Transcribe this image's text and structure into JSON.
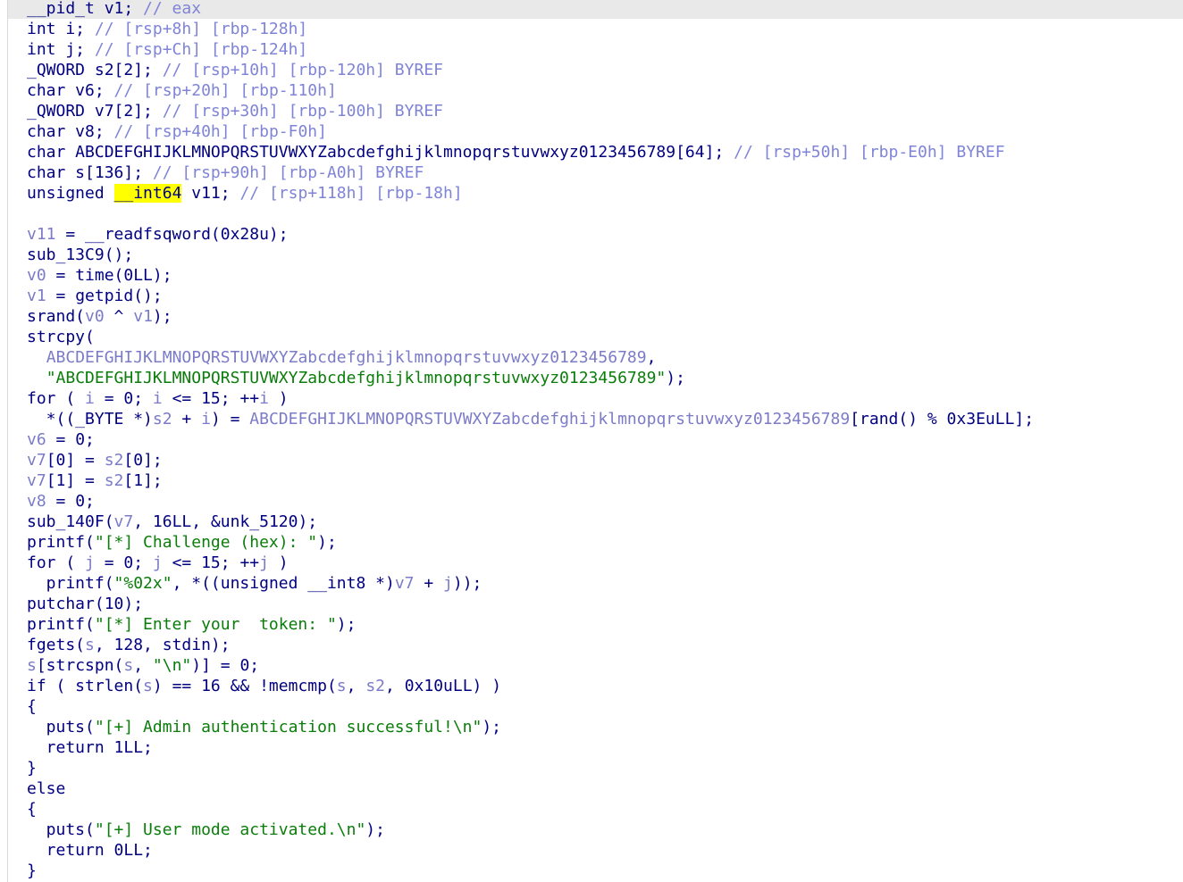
{
  "editor": {
    "highlight_color": "#ffff00",
    "current_line_color": "#e9e9e9",
    "lines": [
      {
        "current": true,
        "tokens": [
          {
            "t": "__pid_t v1; ",
            "c": "plain"
          },
          {
            "t": "// eax",
            "c": "comment"
          }
        ]
      },
      {
        "tokens": [
          {
            "t": "int i; ",
            "c": "plain"
          },
          {
            "t": "// [rsp+8h] [rbp-128h]",
            "c": "comment"
          }
        ]
      },
      {
        "tokens": [
          {
            "t": "int j; ",
            "c": "plain"
          },
          {
            "t": "// [rsp+Ch] [rbp-124h]",
            "c": "comment"
          }
        ]
      },
      {
        "tokens": [
          {
            "t": "_QWORD s2[2]; ",
            "c": "plain"
          },
          {
            "t": "// [rsp+10h] [rbp-120h] BYREF",
            "c": "comment"
          }
        ]
      },
      {
        "tokens": [
          {
            "t": "char v6; ",
            "c": "plain"
          },
          {
            "t": "// [rsp+20h] [rbp-110h]",
            "c": "comment"
          }
        ]
      },
      {
        "tokens": [
          {
            "t": "_QWORD v7[2]; ",
            "c": "plain"
          },
          {
            "t": "// [rsp+30h] [rbp-100h] BYREF",
            "c": "comment"
          }
        ]
      },
      {
        "tokens": [
          {
            "t": "char v8; ",
            "c": "plain"
          },
          {
            "t": "// [rsp+40h] [rbp-F0h]",
            "c": "comment"
          }
        ]
      },
      {
        "tokens": [
          {
            "t": "char ABCDEFGHIJKLMNOPQRSTUVWXYZabcdefghijklmnopqrstuvwxyz0123456789[64]; ",
            "c": "plain"
          },
          {
            "t": "// [rsp+50h] [rbp-E0h] BYREF",
            "c": "comment"
          }
        ]
      },
      {
        "tokens": [
          {
            "t": "char s[136]; ",
            "c": "plain"
          },
          {
            "t": "// [rsp+90h] [rbp-A0h] BYREF",
            "c": "comment"
          }
        ]
      },
      {
        "tokens": [
          {
            "t": "unsigned ",
            "c": "plain"
          },
          {
            "t": "__int64",
            "c": "hl"
          },
          {
            "t": " v11; ",
            "c": "plain"
          },
          {
            "t": "// [rsp+118h] [rbp-18h]",
            "c": "comment"
          }
        ]
      },
      {
        "tokens": []
      },
      {
        "tokens": [
          {
            "t": "v11",
            "c": "var"
          },
          {
            "t": " = __readfsqword(0x28u);",
            "c": "plain"
          }
        ]
      },
      {
        "tokens": [
          {
            "t": "sub_13C9();",
            "c": "plain"
          }
        ]
      },
      {
        "tokens": [
          {
            "t": "v0",
            "c": "var"
          },
          {
            "t": " = time(0LL);",
            "c": "plain"
          }
        ]
      },
      {
        "tokens": [
          {
            "t": "v1",
            "c": "var"
          },
          {
            "t": " = getpid();",
            "c": "plain"
          }
        ]
      },
      {
        "tokens": [
          {
            "t": "srand(",
            "c": "plain"
          },
          {
            "t": "v0",
            "c": "var"
          },
          {
            "t": " ^ ",
            "c": "plain"
          },
          {
            "t": "v1",
            "c": "var"
          },
          {
            "t": ");",
            "c": "plain"
          }
        ]
      },
      {
        "tokens": [
          {
            "t": "strcpy(",
            "c": "plain"
          }
        ]
      },
      {
        "tokens": [
          {
            "t": "  ",
            "c": "plain"
          },
          {
            "t": "ABCDEFGHIJKLMNOPQRSTUVWXYZabcdefghijklmnopqrstuvwxyz0123456789",
            "c": "global"
          },
          {
            "t": ",",
            "c": "plain"
          }
        ]
      },
      {
        "tokens": [
          {
            "t": "  ",
            "c": "plain"
          },
          {
            "t": "\"ABCDEFGHIJKLMNOPQRSTUVWXYZabcdefghijklmnopqrstuvwxyz0123456789\"",
            "c": "string"
          },
          {
            "t": ");",
            "c": "plain"
          }
        ]
      },
      {
        "tokens": [
          {
            "t": "for ( ",
            "c": "plain"
          },
          {
            "t": "i",
            "c": "var"
          },
          {
            "t": " = 0; ",
            "c": "plain"
          },
          {
            "t": "i",
            "c": "var"
          },
          {
            "t": " <= 15; ++",
            "c": "plain"
          },
          {
            "t": "i",
            "c": "var"
          },
          {
            "t": " )",
            "c": "plain"
          }
        ]
      },
      {
        "tokens": [
          {
            "t": "  *((_BYTE *)",
            "c": "plain"
          },
          {
            "t": "s2",
            "c": "var"
          },
          {
            "t": " + ",
            "c": "plain"
          },
          {
            "t": "i",
            "c": "var"
          },
          {
            "t": ") = ",
            "c": "plain"
          },
          {
            "t": "ABCDEFGHIJKLMNOPQRSTUVWXYZabcdefghijklmnopqrstuvwxyz0123456789",
            "c": "global"
          },
          {
            "t": "[rand() % 0x3EuLL];",
            "c": "plain"
          }
        ]
      },
      {
        "tokens": [
          {
            "t": "v6",
            "c": "var"
          },
          {
            "t": " = 0;",
            "c": "plain"
          }
        ]
      },
      {
        "tokens": [
          {
            "t": "v7",
            "c": "var"
          },
          {
            "t": "[0] = ",
            "c": "plain"
          },
          {
            "t": "s2",
            "c": "var"
          },
          {
            "t": "[0];",
            "c": "plain"
          }
        ]
      },
      {
        "tokens": [
          {
            "t": "v7",
            "c": "var"
          },
          {
            "t": "[1] = ",
            "c": "plain"
          },
          {
            "t": "s2",
            "c": "var"
          },
          {
            "t": "[1];",
            "c": "plain"
          }
        ]
      },
      {
        "tokens": [
          {
            "t": "v8",
            "c": "var"
          },
          {
            "t": " = 0;",
            "c": "plain"
          }
        ]
      },
      {
        "tokens": [
          {
            "t": "sub_140F(",
            "c": "plain"
          },
          {
            "t": "v7",
            "c": "var"
          },
          {
            "t": ", 16LL, &unk_5120);",
            "c": "plain"
          }
        ]
      },
      {
        "tokens": [
          {
            "t": "printf(",
            "c": "plain"
          },
          {
            "t": "\"[*] Challenge (hex): \"",
            "c": "string"
          },
          {
            "t": ");",
            "c": "plain"
          }
        ]
      },
      {
        "tokens": [
          {
            "t": "for ( ",
            "c": "plain"
          },
          {
            "t": "j",
            "c": "var"
          },
          {
            "t": " = 0; ",
            "c": "plain"
          },
          {
            "t": "j",
            "c": "var"
          },
          {
            "t": " <= 15; ++",
            "c": "plain"
          },
          {
            "t": "j",
            "c": "var"
          },
          {
            "t": " )",
            "c": "plain"
          }
        ]
      },
      {
        "tokens": [
          {
            "t": "  printf(",
            "c": "plain"
          },
          {
            "t": "\"%02x\"",
            "c": "string"
          },
          {
            "t": ", *((unsigned __int8 *)",
            "c": "plain"
          },
          {
            "t": "v7",
            "c": "var"
          },
          {
            "t": " + ",
            "c": "plain"
          },
          {
            "t": "j",
            "c": "var"
          },
          {
            "t": "));",
            "c": "plain"
          }
        ]
      },
      {
        "tokens": [
          {
            "t": "putchar(10);",
            "c": "plain"
          }
        ]
      },
      {
        "tokens": [
          {
            "t": "printf(",
            "c": "plain"
          },
          {
            "t": "\"[*] Enter your  token: \"",
            "c": "string"
          },
          {
            "t": ");",
            "c": "plain"
          }
        ]
      },
      {
        "tokens": [
          {
            "t": "fgets(",
            "c": "plain"
          },
          {
            "t": "s",
            "c": "var"
          },
          {
            "t": ", 128, stdin);",
            "c": "plain"
          }
        ]
      },
      {
        "tokens": [
          {
            "t": "s",
            "c": "var"
          },
          {
            "t": "[strcspn(",
            "c": "plain"
          },
          {
            "t": "s",
            "c": "var"
          },
          {
            "t": ", ",
            "c": "plain"
          },
          {
            "t": "\"\\n\"",
            "c": "string"
          },
          {
            "t": ")] = 0;",
            "c": "plain"
          }
        ]
      },
      {
        "tokens": [
          {
            "t": "if ( strlen(",
            "c": "plain"
          },
          {
            "t": "s",
            "c": "var"
          },
          {
            "t": ") == 16 && !memcmp(",
            "c": "plain"
          },
          {
            "t": "s",
            "c": "var"
          },
          {
            "t": ", ",
            "c": "plain"
          },
          {
            "t": "s2",
            "c": "var"
          },
          {
            "t": ", 0x10uLL) )",
            "c": "plain"
          }
        ]
      },
      {
        "tokens": [
          {
            "t": "{",
            "c": "plain"
          }
        ]
      },
      {
        "tokens": [
          {
            "t": "  puts(",
            "c": "plain"
          },
          {
            "t": "\"[+] Admin authentication successful!\\n\"",
            "c": "string"
          },
          {
            "t": ");",
            "c": "plain"
          }
        ]
      },
      {
        "tokens": [
          {
            "t": "  return 1LL;",
            "c": "plain"
          }
        ]
      },
      {
        "tokens": [
          {
            "t": "}",
            "c": "plain"
          }
        ]
      },
      {
        "tokens": [
          {
            "t": "else",
            "c": "plain"
          }
        ]
      },
      {
        "tokens": [
          {
            "t": "{",
            "c": "plain"
          }
        ]
      },
      {
        "tokens": [
          {
            "t": "  puts(",
            "c": "plain"
          },
          {
            "t": "\"[+] User mode activated.\\n\"",
            "c": "string"
          },
          {
            "t": ");",
            "c": "plain"
          }
        ]
      },
      {
        "tokens": [
          {
            "t": "  return 0LL;",
            "c": "plain"
          }
        ]
      },
      {
        "tokens": [
          {
            "t": "}",
            "c": "plain"
          }
        ]
      }
    ]
  }
}
